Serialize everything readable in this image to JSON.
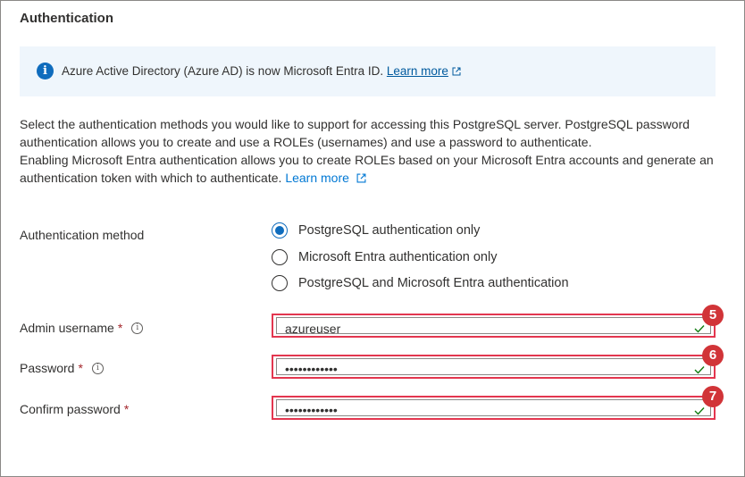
{
  "section": {
    "title": "Authentication"
  },
  "info_bar": {
    "icon": "info-icon",
    "text": "Azure Active Directory (Azure AD) is now Microsoft Entra ID.",
    "link": "Learn more"
  },
  "description": {
    "line1": "Select the authentication methods you would like to support for accessing this PostgreSQL server. PostgreSQL password authentication allows you to create and use a ROLEs (usernames) and use a password to authenticate.",
    "line2": "Enabling Microsoft Entra authentication allows you to create ROLEs based on your Microsoft Entra accounts and generate an authentication token with which to authenticate.",
    "link": "Learn more"
  },
  "auth_method": {
    "label": "Authentication method",
    "selected_index": 0,
    "options": [
      "PostgreSQL authentication only",
      "Microsoft Entra authentication only",
      "PostgreSQL and Microsoft Entra authentication"
    ]
  },
  "fields": {
    "admin_username": {
      "label": "Admin username",
      "required": "*",
      "value": "azureuser",
      "badge": "5"
    },
    "password": {
      "label": "Password",
      "required": "*",
      "value": "••••••••••••",
      "badge": "6"
    },
    "confirm_password": {
      "label": "Confirm password",
      "required": "*",
      "value": "••••••••••••",
      "badge": "7"
    }
  },
  "colors": {
    "accent": "#0f6cbd",
    "highlight_border": "#e3364f",
    "badge": "#d13438",
    "valid_check": "#107c10"
  }
}
